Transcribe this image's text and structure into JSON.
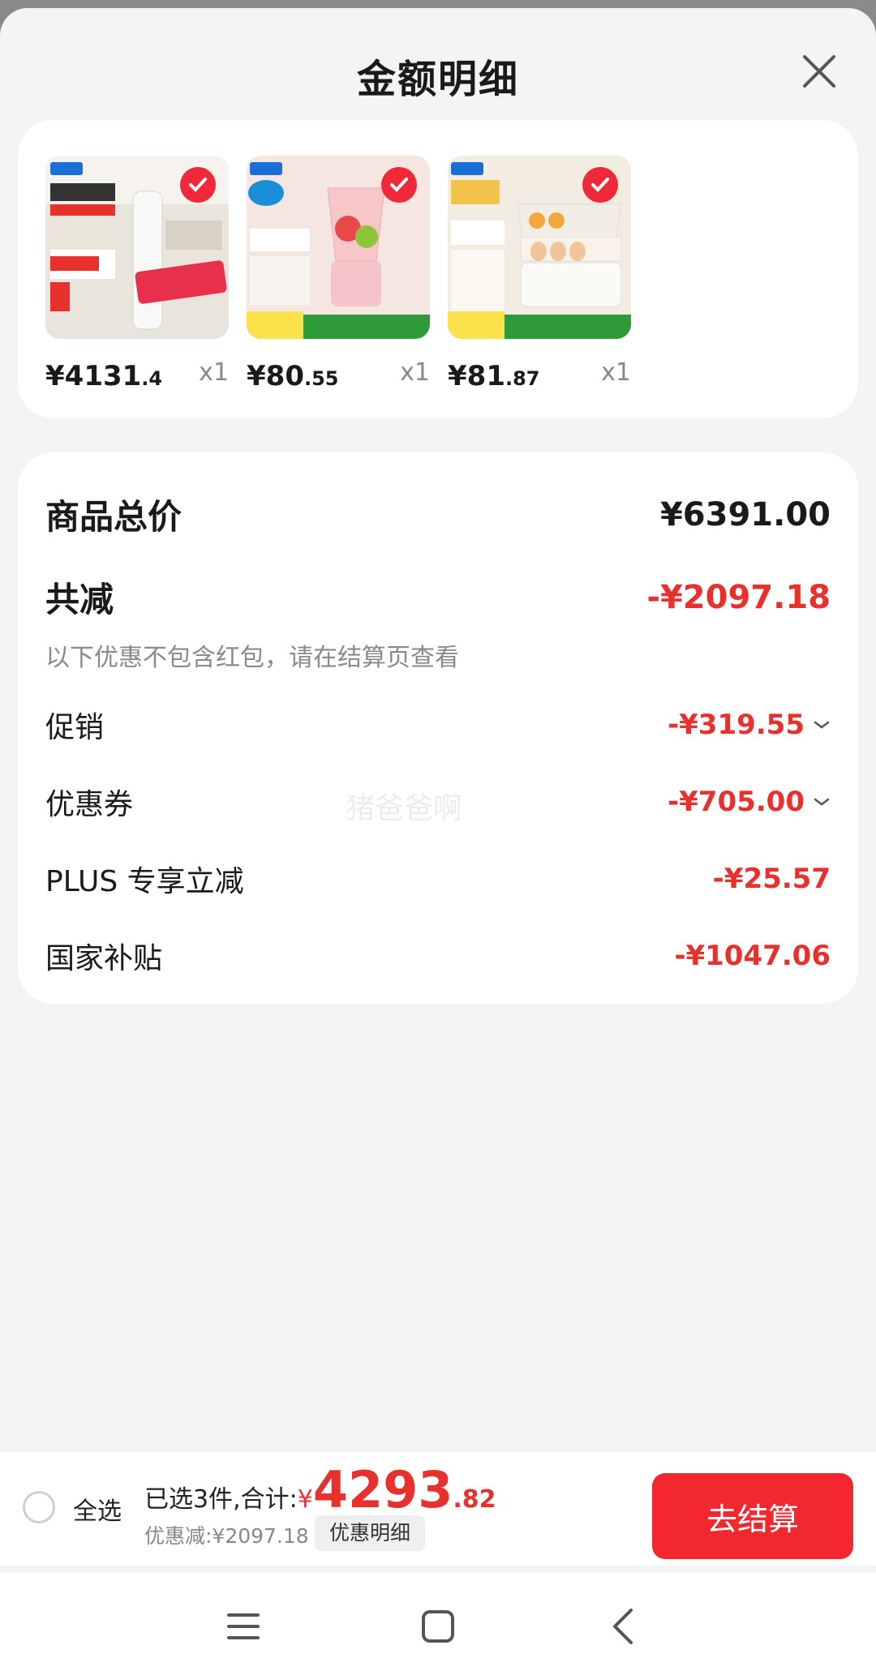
{
  "header": {
    "title": "金额明细"
  },
  "products": [
    {
      "price_int": "¥4131",
      "price_dec": ".4",
      "qty": "x1",
      "image": "air-conditioner"
    },
    {
      "price_int": "¥80",
      "price_dec": ".55",
      "qty": "x1",
      "image": "blender"
    },
    {
      "price_int": "¥81",
      "price_dec": ".87",
      "qty": "x1",
      "image": "egg-cooker"
    }
  ],
  "totals": {
    "goods_total_label": "商品总价",
    "goods_total_value": "¥6391.00",
    "reduce_label": "共减",
    "reduce_value": "-¥2097.18",
    "note": "以下优惠不包含红包，请在结算页查看",
    "promo_label": "促销",
    "promo_value": "-¥319.55",
    "coupon_label": "优惠券",
    "coupon_value": "-¥705.00",
    "plus_label": "PLUS 专享立减",
    "plus_value": "-¥25.57",
    "subsidy_label": "国家补贴",
    "subsidy_value": "-¥1047.06"
  },
  "watermark": "猪爸爸啊",
  "bottom_bar": {
    "select_all": "全选",
    "selected_text": "已选3件,合计:",
    "currency": "¥",
    "total_int": "4293",
    "total_dec": ".82",
    "discount_text": "优惠减:¥2097.18",
    "detail_button": "优惠明细",
    "checkout_button": "去结算"
  },
  "colors": {
    "accent_red": "#e8302c",
    "checkout_red": "#f2282e"
  },
  "nav": {
    "icons": [
      "menu-icon",
      "home-icon",
      "back-icon"
    ]
  }
}
